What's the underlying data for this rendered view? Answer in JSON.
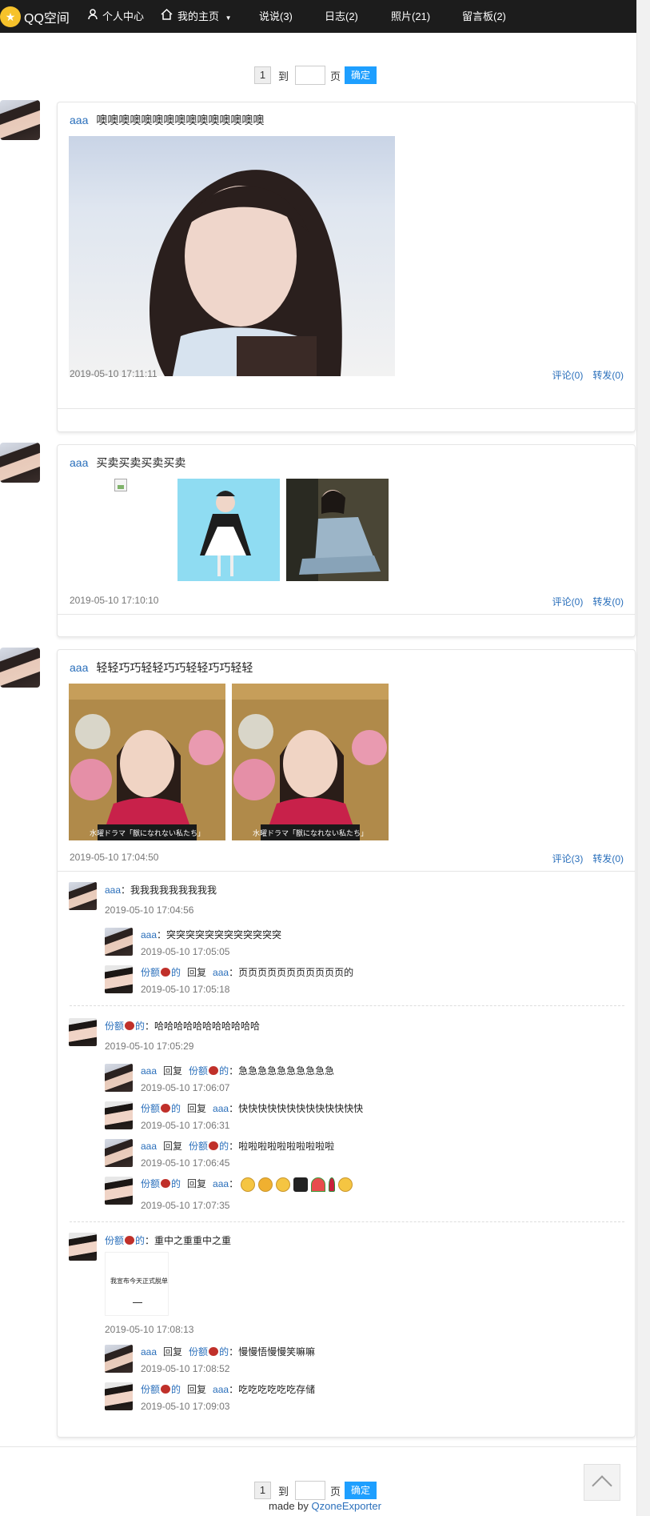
{
  "nav": {
    "logo_text": "QQ空间",
    "logo_icon": "star-icon",
    "items": [
      {
        "label": "个人中心",
        "icon": "person-icon"
      },
      {
        "label": "我的主页",
        "icon": "home-icon",
        "dropdown": true
      },
      {
        "label": "说说(3)"
      },
      {
        "label": "日志(2)"
      },
      {
        "label": "照片(21)"
      },
      {
        "label": "留言板(2)"
      }
    ],
    "background": "#1c1c1c"
  },
  "pager": {
    "current": "1",
    "to_label": "到",
    "page_label": "页",
    "confirm": "确定",
    "accent": "#1e9fff"
  },
  "posts": [
    {
      "author": "aaa",
      "text": "噢噢噢噢噢噢噢噢噢噢噢噢噢噢噢",
      "time": "2019-05-10 17:11:11",
      "comment_label": "评论(0)",
      "share_label": "转发(0)"
    },
    {
      "author": "aaa",
      "text": "买卖买卖买卖买卖",
      "time": "2019-05-10 17:10:10",
      "comment_label": "评论(0)",
      "share_label": "转发(0)"
    },
    {
      "author": "aaa",
      "text": "轻轻巧巧轻轻巧巧轻轻巧巧轻轻",
      "time": "2019-05-10 17:04:50",
      "comment_label": "评论(3)",
      "share_label": "转发(0)",
      "caption": "水曜ドラマ「獣になれない私たち」"
    }
  ],
  "comments": [
    {
      "who": "aaa",
      "text": "：我我我我我我我我我",
      "time": "2019-05-10 17:04:56",
      "replies": [
        {
          "who": "aaa",
          "text": "：突突突突突突突突突突突突",
          "time": "2019-05-10 17:05:05"
        },
        {
          "who": "份额",
          "who_suffix": "的",
          "reply_word": "回复",
          "to": "aaa",
          "text": "：页页页页页页页页页页页的",
          "time": "2019-05-10 17:05:18"
        }
      ]
    },
    {
      "who": "份额",
      "who_suffix": "的",
      "text": "：哈哈哈哈哈哈哈哈哈哈哈",
      "time": "2019-05-10 17:05:29",
      "replies": [
        {
          "who": "aaa",
          "reply_word": "回复",
          "to": "份额",
          "to_suffix": "的",
          "text": "：急急急急急急急急急急",
          "time": "2019-05-10 17:06:07"
        },
        {
          "who": "份额",
          "who_suffix": "的",
          "reply_word": "回复",
          "to": "aaa",
          "text": "：快快快快快快快快快快快快快",
          "time": "2019-05-10 17:06:31"
        },
        {
          "who": "aaa",
          "reply_word": "回复",
          "to": "份额",
          "to_suffix": "的",
          "text": "：啦啦啦啦啦啦啦啦啦啦",
          "time": "2019-05-10 17:06:45"
        },
        {
          "who": "份额",
          "who_suffix": "的",
          "reply_word": "回复",
          "to": "aaa",
          "text": "：",
          "time": "2019-05-10 17:07:35"
        }
      ]
    },
    {
      "who": "份额",
      "who_suffix": "的",
      "text": "：重中之重重中之重",
      "time": "2019-05-10 17:08:13",
      "image_text": "我宣布今天正式脱单",
      "replies": [
        {
          "who": "aaa",
          "reply_word": "回复",
          "to": "份额",
          "to_suffix": "的",
          "text": "：慢慢悟慢慢笑嘛嘛",
          "time": "2019-05-10 17:08:52"
        },
        {
          "who": "份额",
          "who_suffix": "的",
          "reply_word": "回复",
          "to": "aaa",
          "text": "：吃吃吃吃吃吃存储",
          "time": "2019-05-10 17:09:03"
        }
      ]
    }
  ],
  "footer": {
    "made_by": "made by",
    "link": "QzoneExporter"
  },
  "totop_icon": "chevron-up-icon"
}
